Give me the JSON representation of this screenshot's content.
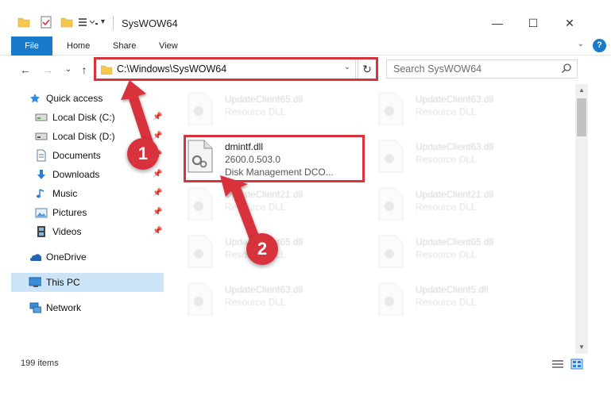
{
  "window": {
    "title": "SysWOW64",
    "minimize": "—",
    "maximize": "☐",
    "close": "✕"
  },
  "ribbon": {
    "tabs": [
      "File",
      "Home",
      "Share",
      "View"
    ],
    "help": "?"
  },
  "nav": {
    "back": "←",
    "forward": "→",
    "recent": "⌄",
    "up": "↑"
  },
  "address": {
    "path": "C:\\Windows\\SysWOW64",
    "refresh": "↻"
  },
  "search": {
    "placeholder": "Search SysWOW64"
  },
  "sidebar": {
    "items": [
      {
        "label": "Quick access",
        "icon": "star-icon"
      },
      {
        "label": "Local Disk (C:)",
        "icon": "drive-icon"
      },
      {
        "label": "Local Disk (D:)",
        "icon": "drive-icon"
      },
      {
        "label": "Documents",
        "icon": "documents-icon"
      },
      {
        "label": "Downloads",
        "icon": "download-icon"
      },
      {
        "label": "Music",
        "icon": "music-icon"
      },
      {
        "label": "Pictures",
        "icon": "pictures-icon"
      },
      {
        "label": "Videos",
        "icon": "videos-icon"
      },
      {
        "label": "OneDrive",
        "icon": "cloud-icon"
      },
      {
        "label": "This PC",
        "icon": "computer-icon"
      },
      {
        "label": "Network",
        "icon": "network-icon"
      }
    ]
  },
  "files": {
    "highlighted": {
      "name": "dmintf.dll",
      "version": "2600.0.503.0",
      "description": "Disk Management DCO..."
    },
    "background": [
      {
        "name": "UpdateClient65.dll",
        "type": "Resource DLL"
      },
      {
        "name": "UpdateClient63.dll",
        "type": "Resource DLL"
      },
      {
        "name": "UpdateClient63.dll",
        "type": "Resource DLL"
      },
      {
        "name": "UpdateClient21.dll",
        "type": "Resource DLL"
      },
      {
        "name": "UpdateClient21.dll",
        "type": "Resource DLL"
      },
      {
        "name": "UpdateClient65.dll",
        "type": "Resource DLL"
      },
      {
        "name": "UpdateClient65.dll",
        "type": "Resource DLL"
      },
      {
        "name": "UpdateClient63.dll",
        "type": "Resource DLL"
      },
      {
        "name": "UpdateClient5.dll",
        "type": "Resource DLL"
      }
    ]
  },
  "status": {
    "count": "199 items"
  },
  "annotations": {
    "step1": "1",
    "step2": "2",
    "color": "#d8323c"
  }
}
